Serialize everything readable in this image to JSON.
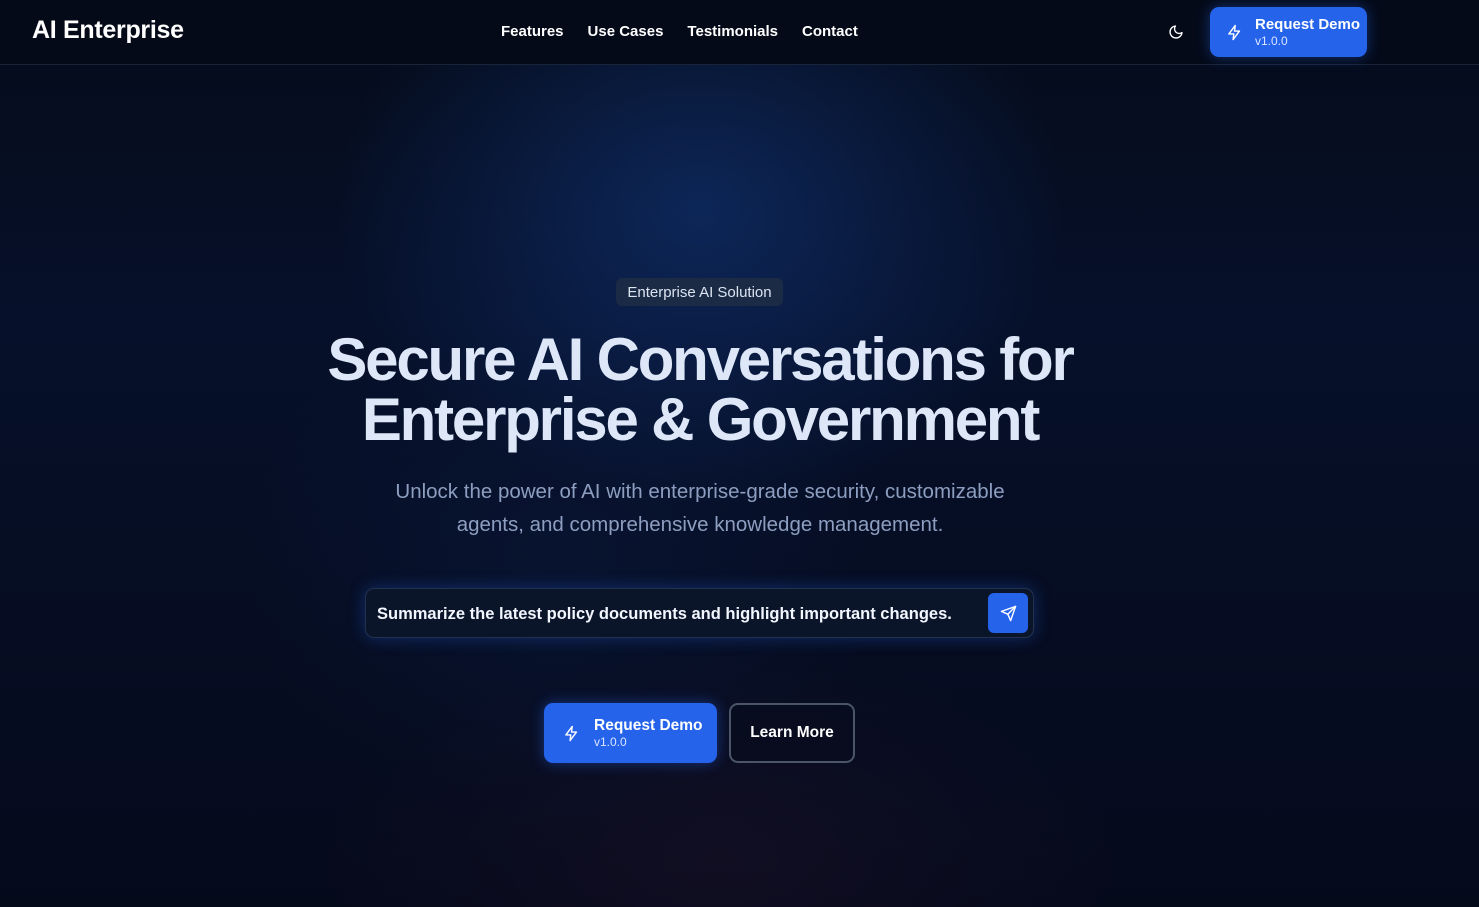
{
  "header": {
    "brand": "AI Enterprise",
    "nav": [
      "Features",
      "Use Cases",
      "Testimonials",
      "Contact"
    ],
    "theme_icon": "moon-icon",
    "demo_button": {
      "label": "Request Demo",
      "version": "v1.0.0",
      "icon": "lightning-icon"
    }
  },
  "hero": {
    "badge": "Enterprise AI Solution",
    "headline_line1": "Secure AI Conversations for",
    "headline_line2": "Enterprise & Government",
    "subhead_line1": "Unlock the power of AI with enterprise-grade security, customizable",
    "subhead_line2": "agents, and comprehensive knowledge management.",
    "prompt": {
      "value": "Summarize the latest policy documents and highlight important changes.",
      "send_icon": "send-icon"
    },
    "demo_button": {
      "label": "Request Demo",
      "version": "v1.0.0",
      "icon": "lightning-icon"
    },
    "learn_more": "Learn More"
  },
  "colors": {
    "accent": "#2563eb",
    "background": "#060d22",
    "text": "#dde7f8",
    "muted": "#8d9ec0"
  }
}
